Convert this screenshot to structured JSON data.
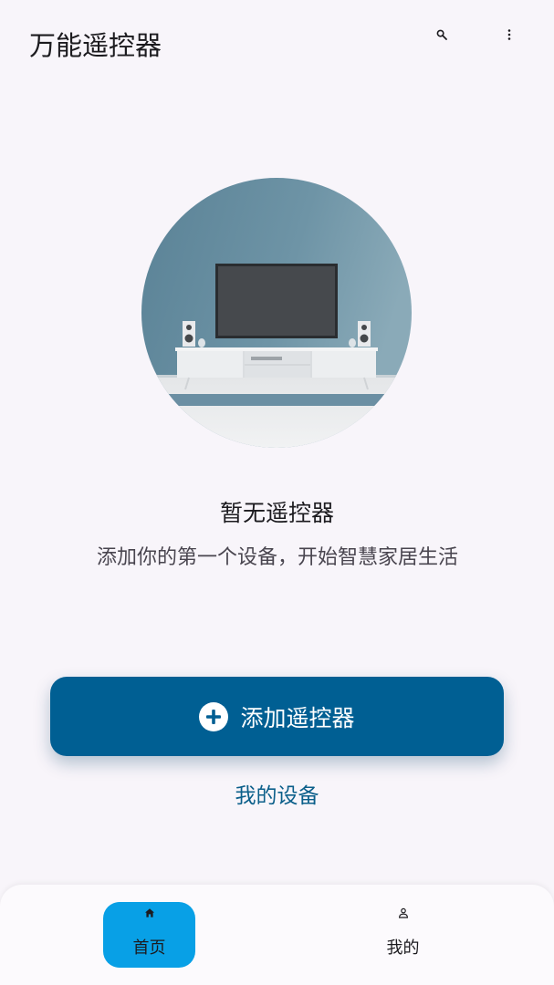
{
  "app_bar": {
    "title": "万能遥控器",
    "search_icon": "search-icon",
    "more_icon": "more-vert-icon"
  },
  "empty_state": {
    "title": "暂无遥控器",
    "description": "添加你的第一个设备，开始智慧家居生活"
  },
  "add_button": {
    "label": "添加遥控器",
    "icon": "add-circle-icon",
    "color": "#005f93"
  },
  "my_devices_link": "我的设备",
  "bottom_nav": {
    "items": [
      {
        "label": "首页",
        "icon": "home-icon",
        "selected": true
      },
      {
        "label": "我的",
        "icon": "person-icon",
        "selected": false
      }
    ],
    "selected_color": "#08a0e6"
  }
}
